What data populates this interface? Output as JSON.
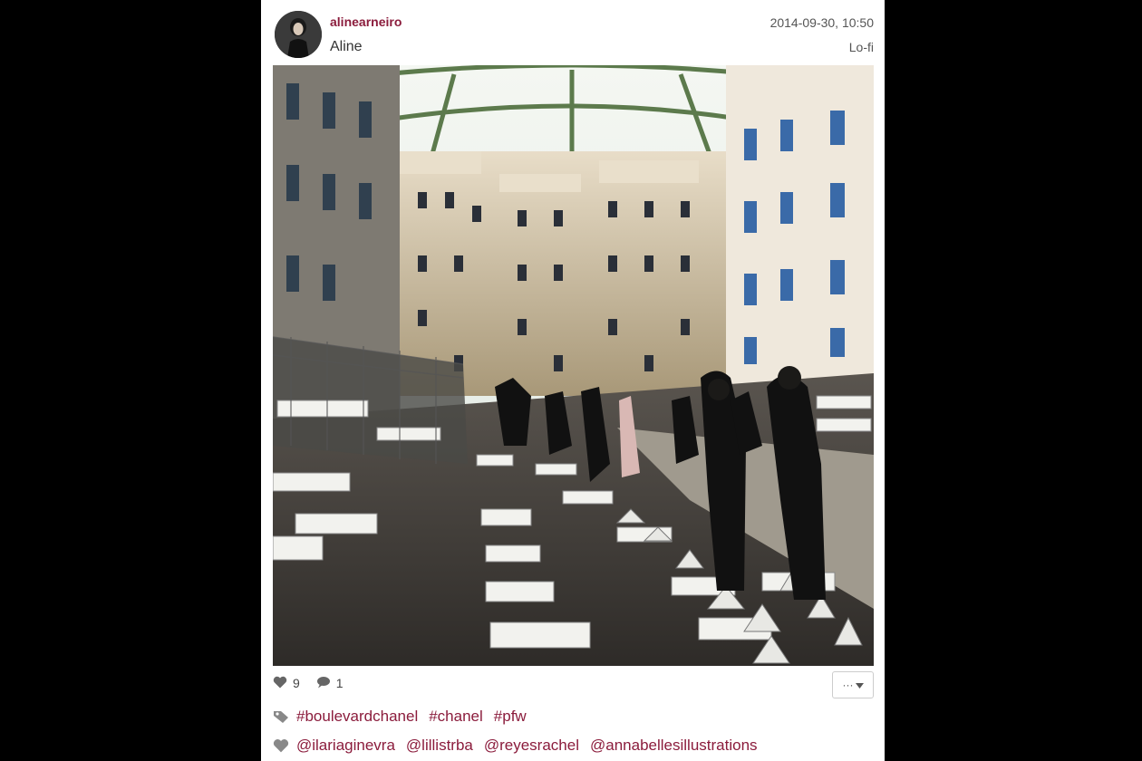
{
  "post": {
    "username": "alinearneiro",
    "display_name": "Aline",
    "timestamp": "2014-09-30, 10:50",
    "filter": "Lo-fi",
    "likes": "9",
    "comments": "1",
    "more_label": "···"
  },
  "tags": [
    "#boulevardchanel",
    "#chanel",
    "#pfw"
  ],
  "users": [
    "@ilariaginevra",
    "@lillistrba",
    "@reyesrachel",
    "@annabellesillustrations"
  ],
  "colors": {
    "accent": "#8b1c3c",
    "page_background": "#000000",
    "card_background": "#ffffff"
  },
  "icons": {
    "likes": "heart-icon",
    "comments": "comment-icon",
    "tags": "tag-icon",
    "users": "heart-icon"
  }
}
